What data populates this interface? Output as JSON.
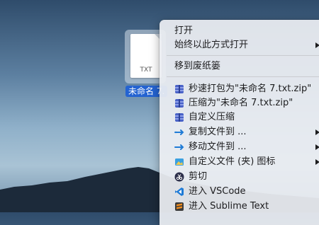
{
  "desktop_file": {
    "name": "未命名 7.",
    "ext": "TXT"
  },
  "context_menu": {
    "open": "打开",
    "always_open_with": "始终以此方式打开",
    "move_to_trash": "移到废纸篓",
    "quick_zip": "秒速打包为\"未命名 7.txt.zip\"",
    "compress": "压缩为\"未命名 7.txt.zip\"",
    "custom_compress": "自定义压缩",
    "copy_to": "复制文件到 ...",
    "move_to": "移动文件到 ...",
    "custom_icon": "自定义文件 (夹) 图标",
    "cut": "剪切",
    "open_vscode": "进入 VSCode",
    "open_sublime": "进入 Sublime Text"
  },
  "colors": {
    "selection": "#2463d1",
    "archive_icon": "#4a63c8",
    "vscode_icon": "#1f7bd6",
    "sublime_icon": "#f08c1e"
  }
}
